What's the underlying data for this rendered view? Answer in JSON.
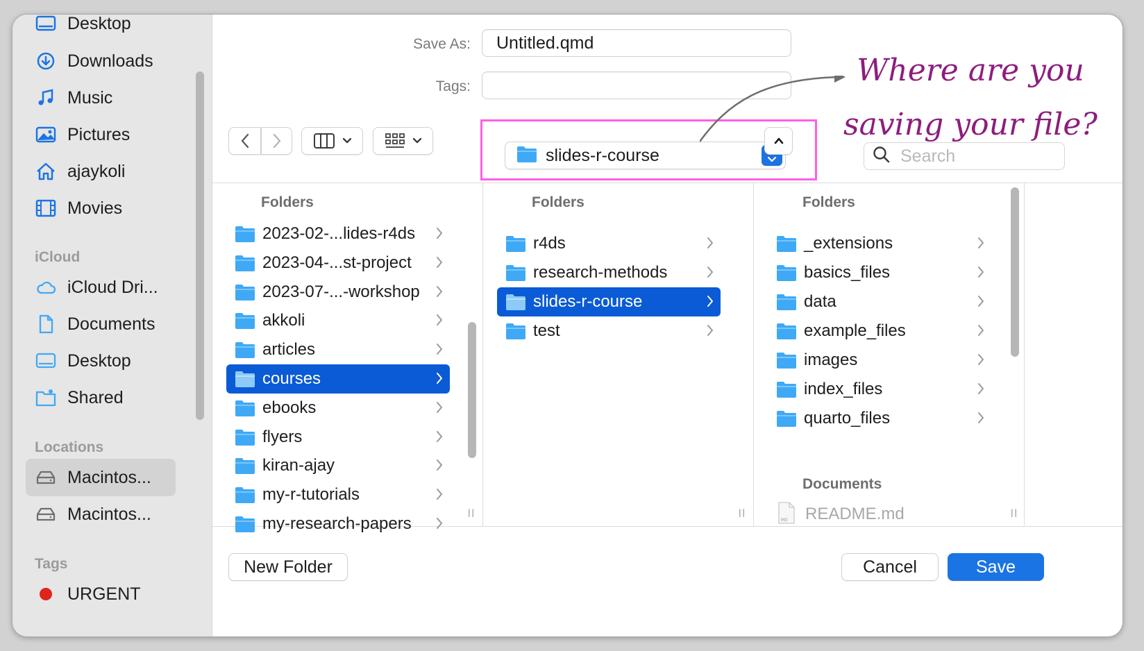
{
  "sidebar": {
    "favorites": [
      {
        "label": "Desktop",
        "icon": "desktop-icon"
      },
      {
        "label": "Downloads",
        "icon": "downloads-icon"
      },
      {
        "label": "Music",
        "icon": "music-icon"
      },
      {
        "label": "Pictures",
        "icon": "pictures-icon"
      },
      {
        "label": "ajaykoli",
        "icon": "home-icon"
      },
      {
        "label": "Movies",
        "icon": "movies-icon"
      }
    ],
    "icloud_header": "iCloud",
    "icloud": [
      {
        "label": "iCloud Dri...",
        "icon": "icloud-icon"
      },
      {
        "label": "Documents",
        "icon": "document-icon"
      },
      {
        "label": "Desktop",
        "icon": "desktop-icon"
      },
      {
        "label": "Shared",
        "icon": "shared-folder-icon"
      }
    ],
    "locations_header": "Locations",
    "locations": [
      {
        "label": "Macintos...",
        "icon": "disk-icon",
        "selected": true
      },
      {
        "label": "Macintos...",
        "icon": "disk-icon",
        "selected": false
      }
    ],
    "tags_header": "Tags",
    "tags": [
      {
        "label": "URGENT",
        "color": "#e0241c"
      }
    ]
  },
  "form": {
    "save_as_label": "Save As:",
    "save_as_value": "Untitled.qmd",
    "tags_label": "Tags:",
    "tags_value": ""
  },
  "toolbar": {
    "back_icon": "chevron-left-icon",
    "forward_icon": "chevron-right-icon",
    "view_icon": "columns-view-icon",
    "group_icon": "grid-group-icon",
    "location": "slides-r-course",
    "search_placeholder": "Search"
  },
  "annotation": {
    "line1": "Where are you",
    "line2": "saving your file?"
  },
  "columns": [
    {
      "header": "Folders",
      "rows": [
        {
          "label": "2023-02-...lides-r4ds",
          "selected": false
        },
        {
          "label": "2023-04-...st-project",
          "selected": false
        },
        {
          "label": "2023-07-...-workshop",
          "selected": false
        },
        {
          "label": "akkoli",
          "selected": false
        },
        {
          "label": "articles",
          "selected": false
        },
        {
          "label": "courses",
          "selected": true
        },
        {
          "label": "ebooks",
          "selected": false
        },
        {
          "label": "flyers",
          "selected": false
        },
        {
          "label": "kiran-ajay",
          "selected": false
        },
        {
          "label": "my-r-tutorials",
          "selected": false
        },
        {
          "label": "my-research-papers",
          "selected": false
        }
      ]
    },
    {
      "header": "Folders",
      "rows": [
        {
          "label": "r4ds",
          "selected": false
        },
        {
          "label": "research-methods",
          "selected": false
        },
        {
          "label": "slides-r-course",
          "selected": true
        },
        {
          "label": "test",
          "selected": false
        }
      ]
    },
    {
      "header": "Folders",
      "rows": [
        {
          "label": "_extensions",
          "selected": false
        },
        {
          "label": "basics_files",
          "selected": false
        },
        {
          "label": "data",
          "selected": false
        },
        {
          "label": "example_files",
          "selected": false
        },
        {
          "label": "images",
          "selected": false
        },
        {
          "label": "index_files",
          "selected": false
        },
        {
          "label": "quarto_files",
          "selected": false
        }
      ],
      "documents_header": "Documents",
      "documents": [
        {
          "label": "README.md",
          "icon_text": "MD"
        }
      ]
    }
  ],
  "buttons": {
    "new_folder": "New Folder",
    "cancel": "Cancel",
    "save": "Save"
  },
  "colors": {
    "accent": "#1b74e4",
    "selection": "#0a5bd5",
    "folder": "#3fa9f5",
    "highlight_box": "#ff5fe3",
    "annotation": "#8d1d7e"
  }
}
